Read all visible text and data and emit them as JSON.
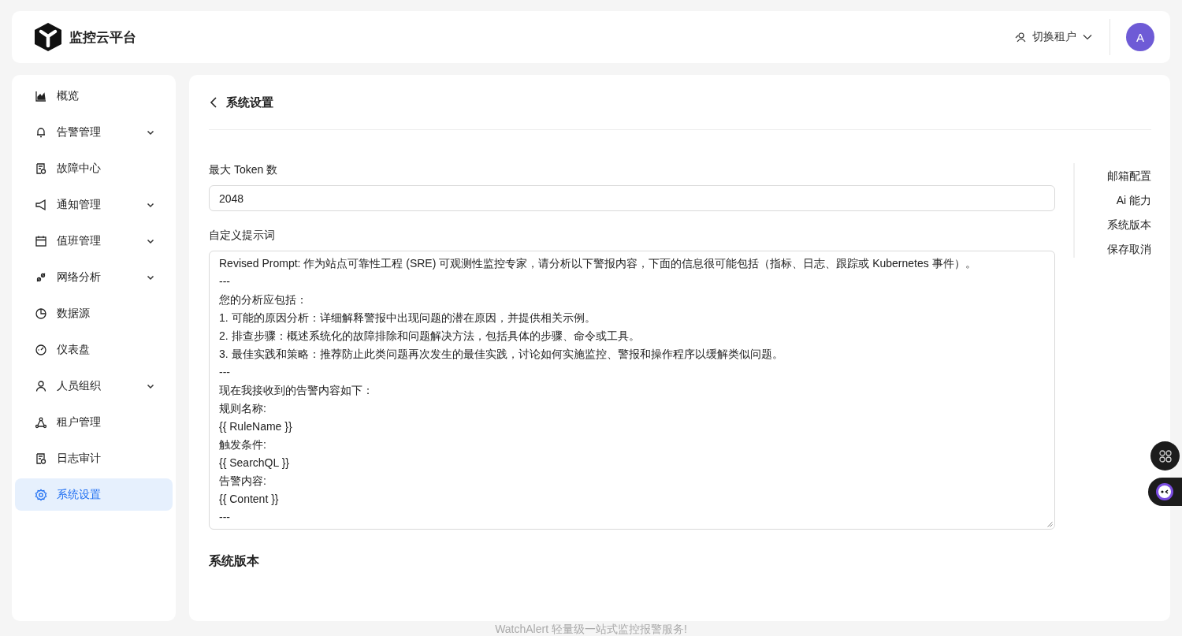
{
  "header": {
    "brand": "监控云平台",
    "tenant_switch": {
      "label": "切换租户",
      "expanded": false
    },
    "avatar": "A"
  },
  "sidebar": {
    "items": [
      {
        "label": "概览",
        "expandable": false,
        "selected": false
      },
      {
        "label": "告警管理",
        "expandable": true,
        "selected": false
      },
      {
        "label": "故障中心",
        "expandable": false,
        "selected": false
      },
      {
        "label": "通知管理",
        "expandable": true,
        "selected": false
      },
      {
        "label": "值班管理",
        "expandable": true,
        "selected": false
      },
      {
        "label": "网络分析",
        "expandable": true,
        "selected": false
      },
      {
        "label": "数据源",
        "expandable": false,
        "selected": false
      },
      {
        "label": "仪表盘",
        "expandable": false,
        "selected": false
      },
      {
        "label": "人员组织",
        "expandable": true,
        "selected": false
      },
      {
        "label": "租户管理",
        "expandable": false,
        "selected": false
      },
      {
        "label": "日志审计",
        "expandable": false,
        "selected": false
      },
      {
        "label": "系统设置",
        "expandable": false,
        "selected": true
      }
    ]
  },
  "page": {
    "title": "系统设置",
    "fields": [
      {
        "label": "最大 Token 数",
        "kind": "input",
        "value": "2048"
      },
      {
        "label": "自定义提示词",
        "kind": "textarea",
        "lines": [
          "Revised Prompt: 作为站点可靠性工程 (SRE) 可观测性监控专家，请分析以下警报内容，下面的信息很可能包括（指标、日志、跟踪或 Kubernetes 事件）。",
          "---",
          "您的分析应包括：",
          "1. 可能的原因分析：详细解释警报中出现问题的潜在原因，并提供相关示例。",
          "2. 排查步骤：概述系统化的故障排除和问题解决方法，包括具体的步骤、命令或工具。",
          "3. 最佳实践和策略：推荐防止此类问题再次发生的最佳实践，讨论如何实施监控、警报和操作程序以缓解类似问题。",
          "---",
          "现在我接收到的告警内容如下：",
          "规则名称:",
          "{{ RuleName }}",
          "触发条件:",
          "{{ SearchQL }}",
          "告警内容:",
          "{{ Content }}",
          "---"
        ]
      }
    ],
    "section_heading": "系统版本",
    "anchors": [
      "邮箱配置",
      "Ai 能力",
      "系统版本",
      "保存取消"
    ]
  },
  "footer": "WatchAlert 轻量级一站式监控报警服务!"
}
